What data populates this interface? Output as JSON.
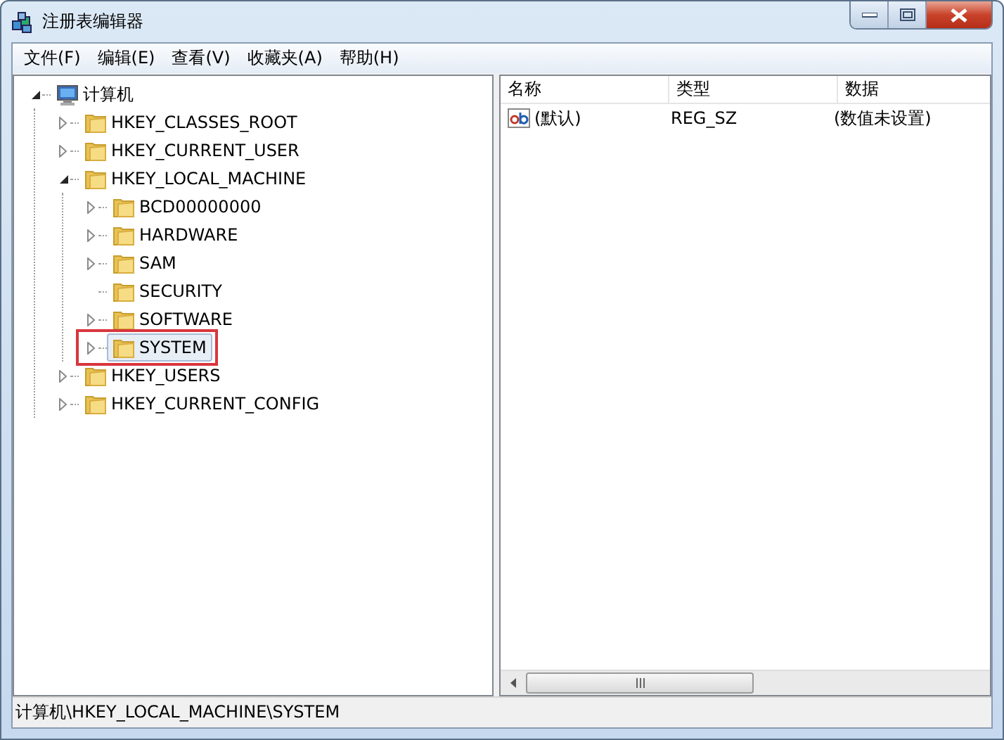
{
  "window": {
    "title": "注册表编辑器"
  },
  "menu": [
    "文件(F)",
    "编辑(E)",
    "查看(V)",
    "收藏夹(A)",
    "帮助(H)"
  ],
  "tree": {
    "label": "计算机",
    "kind": "computer",
    "expandable": true,
    "expanded": true,
    "selected": false,
    "highlighted": false,
    "children": [
      {
        "label": "HKEY_CLASSES_ROOT",
        "kind": "folder",
        "expandable": true,
        "expanded": false,
        "selected": false,
        "highlighted": false
      },
      {
        "label": "HKEY_CURRENT_USER",
        "kind": "folder",
        "expandable": true,
        "expanded": false,
        "selected": false,
        "highlighted": false
      },
      {
        "label": "HKEY_LOCAL_MACHINE",
        "kind": "folder",
        "expandable": true,
        "expanded": true,
        "selected": false,
        "highlighted": false,
        "children": [
          {
            "label": "BCD00000000",
            "kind": "folder",
            "expandable": true,
            "expanded": false,
            "selected": false,
            "highlighted": false
          },
          {
            "label": "HARDWARE",
            "kind": "folder",
            "expandable": true,
            "expanded": false,
            "selected": false,
            "highlighted": false
          },
          {
            "label": "SAM",
            "kind": "folder",
            "expandable": true,
            "expanded": false,
            "selected": false,
            "highlighted": false
          },
          {
            "label": "SECURITY",
            "kind": "folder",
            "expandable": false,
            "selected": false,
            "highlighted": false
          },
          {
            "label": "SOFTWARE",
            "kind": "folder",
            "expandable": true,
            "expanded": false,
            "selected": false,
            "highlighted": false
          },
          {
            "label": "SYSTEM",
            "kind": "folder",
            "expandable": true,
            "expanded": false,
            "selected": true,
            "highlighted": true
          }
        ]
      },
      {
        "label": "HKEY_USERS",
        "kind": "folder",
        "expandable": true,
        "expanded": false,
        "selected": false,
        "highlighted": false
      },
      {
        "label": "HKEY_CURRENT_CONFIG",
        "kind": "folder",
        "expandable": true,
        "expanded": false,
        "selected": false,
        "highlighted": false
      }
    ]
  },
  "list": {
    "columns": [
      "名称",
      "类型",
      "数据"
    ],
    "rows": [
      {
        "name": "(默认)",
        "type": "REG_SZ",
        "data": "(数值未设置)"
      }
    ]
  },
  "status_bar": "计算机\\HKEY_LOCAL_MACHINE\\SYSTEM"
}
